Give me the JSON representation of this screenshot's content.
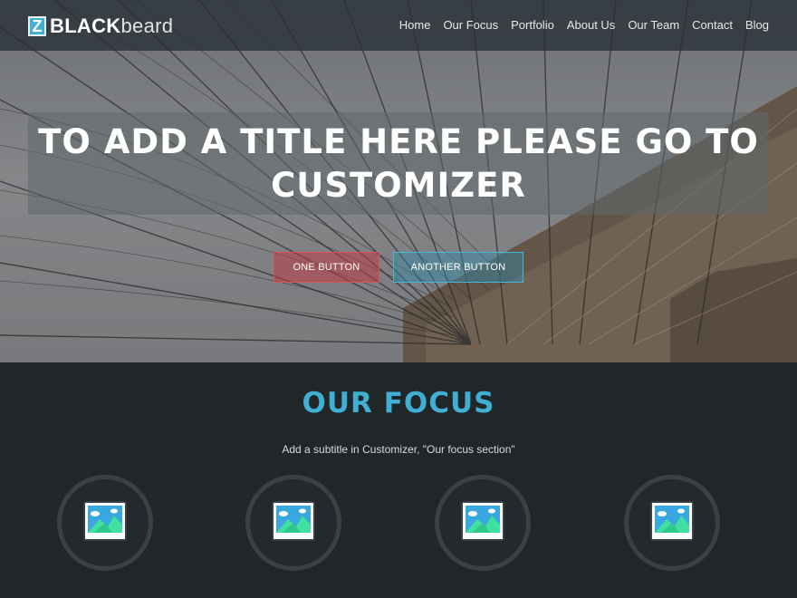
{
  "brand": {
    "mark": "Z",
    "strong": "BLACK",
    "light": "beard"
  },
  "nav": {
    "items": [
      "Home",
      "Our Focus",
      "Portfolio",
      "About Us",
      "Our Team",
      "Contact",
      "Blog"
    ]
  },
  "hero": {
    "title": "TO ADD A TITLE HERE PLEASE GO TO CUSTOMIZER",
    "button_one": "ONE BUTTON",
    "button_two": "ANOTHER BUTTON"
  },
  "focus": {
    "title": "OUR FOCUS",
    "subtitle": "Add a subtitle in Customizer, \"Our focus section\"",
    "items": [
      {
        "icon": "image-placeholder-icon"
      },
      {
        "icon": "image-placeholder-icon"
      },
      {
        "icon": "image-placeholder-icon"
      },
      {
        "icon": "image-placeholder-icon"
      }
    ]
  },
  "colors": {
    "accent": "#3fb0d4",
    "button_one_border": "#d9535c",
    "button_two_border": "#46b9d9",
    "section_background": "#212729"
  }
}
